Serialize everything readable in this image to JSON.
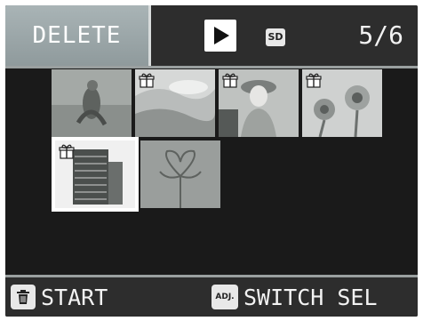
{
  "header": {
    "mode_label": "DELETE",
    "playback_icon": "play-icon",
    "storage_icon": "sd-card-icon",
    "storage_label": "SD",
    "counter": "5/6"
  },
  "thumbnails": [
    {
      "name": "thumb-1",
      "icon": "gift-protect-icon",
      "has_icon": false,
      "selected": false,
      "subject": "figure"
    },
    {
      "name": "thumb-2",
      "icon": "gift-protect-icon",
      "has_icon": true,
      "selected": false,
      "subject": "sky"
    },
    {
      "name": "thumb-3",
      "icon": "gift-protect-icon",
      "has_icon": true,
      "selected": false,
      "subject": "person"
    },
    {
      "name": "thumb-4",
      "icon": "gift-protect-icon",
      "has_icon": true,
      "selected": false,
      "subject": "flowers"
    },
    {
      "name": "thumb-5",
      "icon": "gift-protect-icon",
      "has_icon": true,
      "selected": true,
      "subject": "building"
    },
    {
      "name": "thumb-6",
      "icon": "gift-protect-icon",
      "has_icon": false,
      "selected": false,
      "subject": "flower"
    }
  ],
  "footer": {
    "start_icon": "trash-icon",
    "start_label": "START",
    "switch_icon": "adj-button-icon",
    "switch_icon_text": "ADJ.",
    "switch_label": "SWITCH SEL"
  },
  "colors": {
    "background": "#1a1a1a",
    "bar": "#2d2d2d",
    "mode_tab": "#9aa4a6",
    "text": "#f2f2f2"
  }
}
